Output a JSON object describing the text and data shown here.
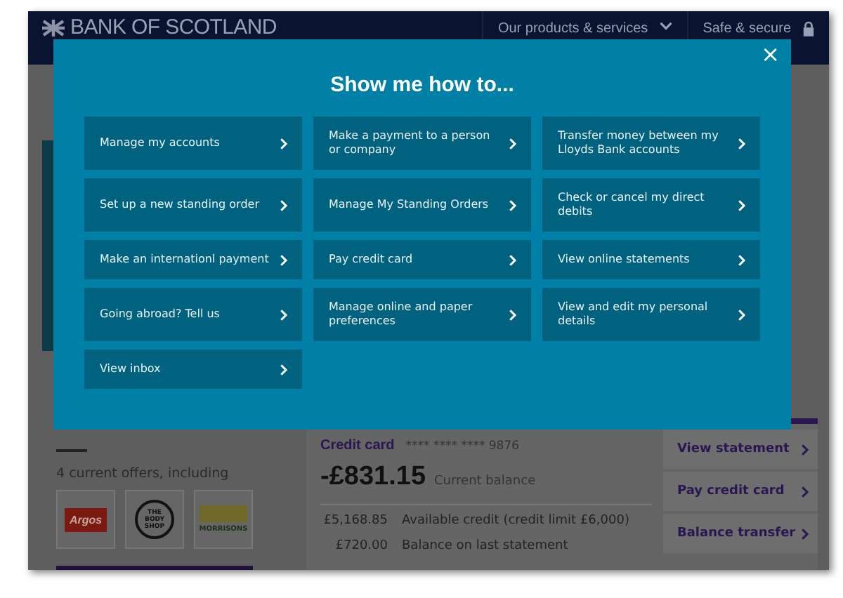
{
  "header": {
    "logo": "BANK OF SCOTLAND",
    "nav": [
      {
        "label": "Our products & services",
        "kind": "dropdown"
      },
      {
        "label": "Safe & secure",
        "kind": "lock"
      }
    ]
  },
  "offers": {
    "text": "4 current offers, including",
    "logos": [
      {
        "label": "Argos",
        "kind": "argos"
      },
      {
        "label": "THE BODY SHOP",
        "kind": "bodyshop"
      },
      {
        "label": "MORRISONS",
        "kind": "morrisons"
      }
    ]
  },
  "credit_card": {
    "title": "Credit card",
    "number": "**** **** **** 9876",
    "balance": "-£831.15",
    "balance_label": "Current balance",
    "rows": [
      {
        "amount": "£5,168.85",
        "label": "Available credit (credit limit £6,000)"
      },
      {
        "amount": "£720.00",
        "label": "Balance on last statement"
      }
    ],
    "actions": [
      "View statement",
      "Pay credit card",
      "Balance transfer"
    ]
  },
  "modal": {
    "title": "Show me how to...",
    "close": "×",
    "tasks": [
      "Manage my accounts",
      "Make a payment to a person or company",
      "Transfer money between my Lloyds Bank accounts",
      "Set up a new standing order",
      "Manage My Standing Orders",
      "Check or cancel my direct debits",
      "Make an internationl payment",
      "Pay credit card",
      "View online statements",
      "Going abroad? Tell us",
      "Manage online and paper preferences",
      "View and edit my personal details",
      "View inbox"
    ]
  }
}
